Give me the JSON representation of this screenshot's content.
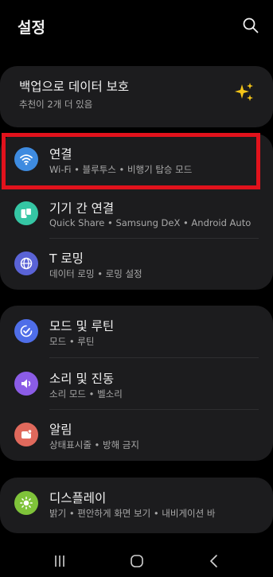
{
  "header": {
    "title": "설정",
    "search_icon": "search-icon"
  },
  "backup": {
    "title": "백업으로 데이터 보호",
    "subtitle": "추천이 2개 더 있음",
    "icon": "sparkle-icon",
    "icon_color": "#f5c518"
  },
  "groups": [
    {
      "items": [
        {
          "title": "연결",
          "subtitle": "Wi-Fi  •  블루투스  •  비행기 탑승 모드",
          "icon": "wifi-icon",
          "color": "#3e8be0"
        },
        {
          "title": "기기 간 연결",
          "subtitle": "Quick Share  •  Samsung DeX  •  Android Auto",
          "icon": "device-connect-icon",
          "color": "#35c6a4"
        },
        {
          "title": "T 로밍",
          "subtitle": "데이터 로밍  •  로밍 설정",
          "icon": "globe-icon",
          "color": "#5a63d6"
        }
      ]
    },
    {
      "items": [
        {
          "title": "모드 및 루틴",
          "subtitle": "모드  •  루틴",
          "icon": "modes-icon",
          "color": "#4f6ee8"
        },
        {
          "title": "소리 및 진동",
          "subtitle": "소리 모드  •  벨소리",
          "icon": "volume-icon",
          "color": "#8b5ce6"
        },
        {
          "title": "알림",
          "subtitle": "상태표시줄  •  방해 금지",
          "icon": "notification-icon",
          "color": "#e0695c"
        }
      ]
    },
    {
      "items": [
        {
          "title": "디스플레이",
          "subtitle": "밝기  •  편안하게 화면 보기  •  내비게이션 바",
          "icon": "brightness-icon",
          "color": "#7fc33a"
        }
      ]
    }
  ],
  "highlight_color": "#e1121c",
  "navbar": {
    "recent": "recent-apps-icon",
    "home": "home-icon",
    "back": "back-icon"
  }
}
